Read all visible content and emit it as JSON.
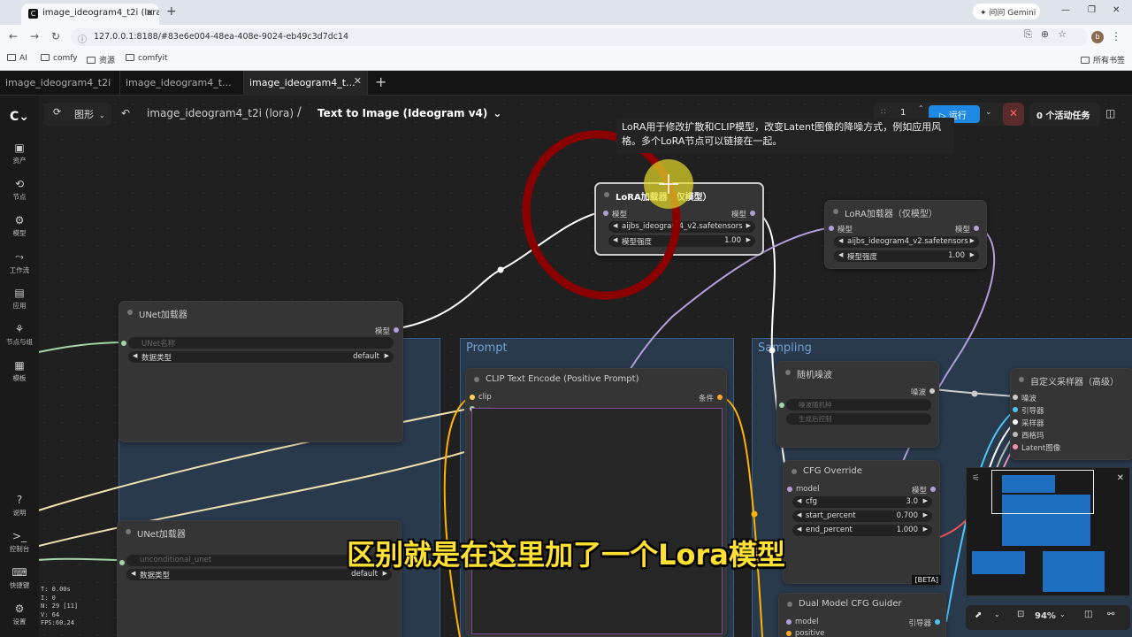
{
  "browser": {
    "tab_title": "image_ideogram4_t2i (lora) -",
    "favicon": "C",
    "new_tab": "+",
    "gemini": "问问 Gemini",
    "url": "127.0.0.1:8188/#83e6e004-48ea-408e-9024-eb49c3d7dc14",
    "avatar": "b",
    "bookmarks": [
      "AI",
      "comfy",
      "资源",
      "comfyit"
    ],
    "bookmarks_right": "所有书签"
  },
  "app_tabs": [
    "image_ideogram4_t2i",
    "image_ideogram4_t...",
    "image_ideogram4_t..."
  ],
  "toolbar": {
    "mode": "图形",
    "breadcrumb_root": "image_ideogram4_t2i (lora)",
    "separator": "/",
    "breadcrumb_current": "Text to Image (Ideogram v4)",
    "queue_count": "1",
    "run_label": "运行",
    "active_tasks": "0 个活动任务"
  },
  "sidebar": [
    {
      "icon": "image-icon",
      "label": "资产"
    },
    {
      "icon": "node-icon",
      "label": "节点"
    },
    {
      "icon": "model-icon",
      "label": "模型"
    },
    {
      "icon": "workflow-icon",
      "label": "工作流"
    },
    {
      "icon": "app-icon",
      "label": "应用"
    },
    {
      "icon": "group-icon",
      "label": "节点与组"
    },
    {
      "icon": "template-icon",
      "label": "模板"
    }
  ],
  "sidebar_bottom": [
    {
      "icon": "help-icon",
      "label": "说明"
    },
    {
      "icon": "console-icon",
      "label": "控制台"
    },
    {
      "icon": "keyboard-icon",
      "label": "快捷键"
    },
    {
      "icon": "settings-icon",
      "label": "设置"
    }
  ],
  "stats": [
    "T: 0.00s",
    "I: 0",
    "N: 29 [11]",
    "V: 64",
    "FPS:60.24"
  ],
  "tooltip": "LoRA用于修改扩散和CLIP模型，改变Latent图像的降噪方式，例如应用风格。多个LoRA节点可以链接在一起。",
  "groups": {
    "prompt": "Prompt",
    "sampling": "Sampling"
  },
  "nodes": {
    "lora1": {
      "title": "LoRA加载器（仅模型）",
      "in": "模型",
      "out": "模型",
      "file": "aijbs_ideogram4_v2.safetensors",
      "strength_label": "模型强度",
      "strength": "1.00"
    },
    "lora2": {
      "title": "LoRA加载器（仅模型）",
      "in": "模型",
      "out": "模型",
      "file": "aijbs_ideogram4_v2.safetensors",
      "strength_label": "模型强度",
      "strength": "1.00"
    },
    "unet1": {
      "title": "UNet加载器",
      "out": "模型",
      "name_ph": "UNet名称",
      "dtype_label": "数据类型",
      "dtype": "default"
    },
    "unet2": {
      "title": "UNet加载器",
      "name_ph": "unconditional_unet",
      "dtype_label": "数据类型",
      "dtype": "default"
    },
    "clip": {
      "title": "CLIP Text Encode (Positive Prompt)",
      "in": "clip",
      "out": "条件",
      "text": "text"
    },
    "noise": {
      "title": "随机噪波",
      "out": "噪波",
      "seed": "噪波随机种",
      "control": "生成后控制"
    },
    "cfgo": {
      "title": "CFG Override",
      "in": "model",
      "out": "模型",
      "cfg_label": "cfg",
      "cfg": "3.0",
      "sp_label": "start_percent",
      "sp": "0.700",
      "ep_label": "end_percent",
      "ep": "1.000",
      "badge": "[BETA]"
    },
    "dual": {
      "title": "Dual Model CFG Guider",
      "in1": "model",
      "in2": "positive",
      "out": "引导器"
    },
    "custom": {
      "title": "自定义采样器（高级）",
      "ins": [
        "噪波",
        "引导器",
        "采样器",
        "西格玛",
        "Latent图像"
      ]
    }
  },
  "subtitle": "区别就是在这里加了一个Lora模型",
  "zoom": "94%"
}
